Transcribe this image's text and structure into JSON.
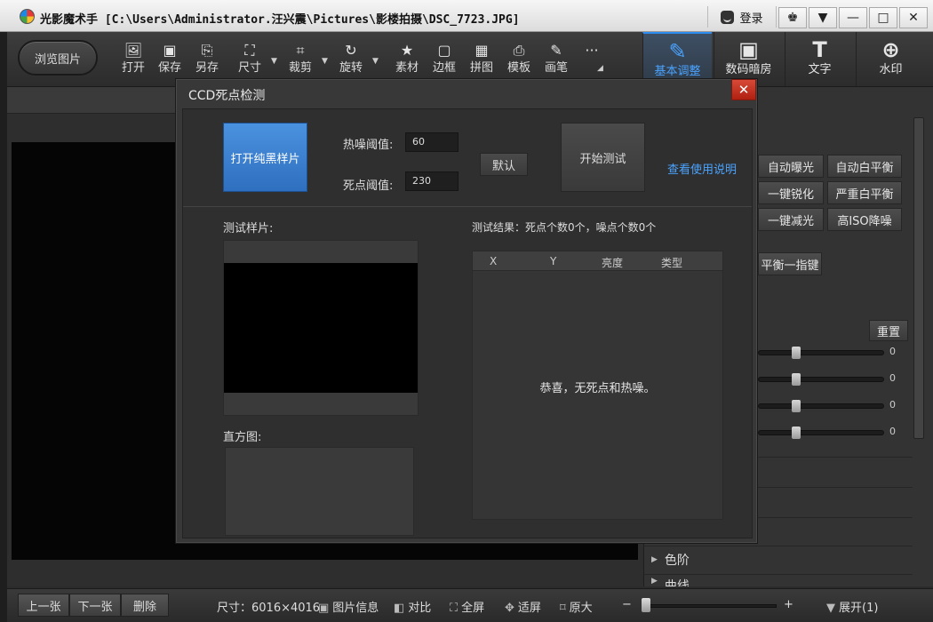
{
  "window": {
    "app_name": "光影魔术手",
    "path": "[C:\\Users\\Administrator.汪兴震\\Pictures\\影楼拍摄\\DSC_7723.JPG]",
    "login_label": "登录",
    "buttons": {
      "skin": "♚",
      "menu": "▼",
      "minimize": "—",
      "maximize": "□",
      "close": "✕"
    }
  },
  "toolbar": {
    "browse_label": "浏览图片",
    "tools": [
      {
        "label": "打开",
        "icon": "🖼"
      },
      {
        "label": "保存",
        "icon": "▣"
      },
      {
        "label": "另存",
        "icon": "⎘"
      },
      {
        "label": "尺寸",
        "icon": "⛶"
      },
      {
        "label": "裁剪",
        "icon": "⌗"
      },
      {
        "label": "旋转",
        "icon": "↻"
      },
      {
        "label": "素材",
        "icon": "★"
      },
      {
        "label": "边框",
        "icon": "▢"
      },
      {
        "label": "拼图",
        "icon": "▦"
      },
      {
        "label": "模板",
        "icon": "⎙"
      },
      {
        "label": "画笔",
        "icon": "✎"
      },
      {
        "label": "",
        "icon": "···"
      }
    ],
    "panels": [
      {
        "label": "基本调整",
        "icon": "✎",
        "active": true
      },
      {
        "label": "数码暗房",
        "icon": "▣",
        "active": false
      },
      {
        "label": "文字",
        "icon": "T",
        "active": false
      },
      {
        "label": "水印",
        "icon": "⊕",
        "active": false
      }
    ]
  },
  "right_panel": {
    "quick_buttons": [
      "自动曝光",
      "自动白平衡",
      "一键锐化",
      "严重白平衡",
      "一键减光",
      "高ISO降噪"
    ],
    "balance_button": "平衡一指键",
    "reset_label": "重置",
    "sliders": [
      0,
      0,
      0,
      0
    ],
    "sections": [
      "色阶",
      "曲线"
    ]
  },
  "dialog": {
    "title": "CCD死点检测",
    "close_icon": "✕",
    "open_sample_button": "打开纯黑样片",
    "hot_noise_label": "热噪阈值:",
    "hot_noise_value": "60",
    "dead_pixel_label": "死点阈值:",
    "dead_pixel_value": "230",
    "default_button": "默认",
    "start_test_button": "开始测试",
    "help_link": "查看使用说明",
    "sample_label": "测试样片:",
    "histogram_label": "直方图:",
    "result_summary": "测试结果：死点个数0个，噪点个数0个",
    "table_headers": [
      "X",
      "Y",
      "亮度",
      "类型"
    ],
    "empty_message": "恭喜，无死点和热噪。"
  },
  "bottombar": {
    "prev_label": "上一张",
    "next_label": "下一张",
    "delete_label": "删除",
    "size_text": "尺寸：6016×4016",
    "info_label": "图片信息",
    "compare_label": "对比",
    "fullscreen_label": "全屏",
    "fit_label": "适屏",
    "original_label": "原大",
    "zoom_minus": "−",
    "zoom_plus": "+",
    "expand_label": "展开(1)"
  }
}
